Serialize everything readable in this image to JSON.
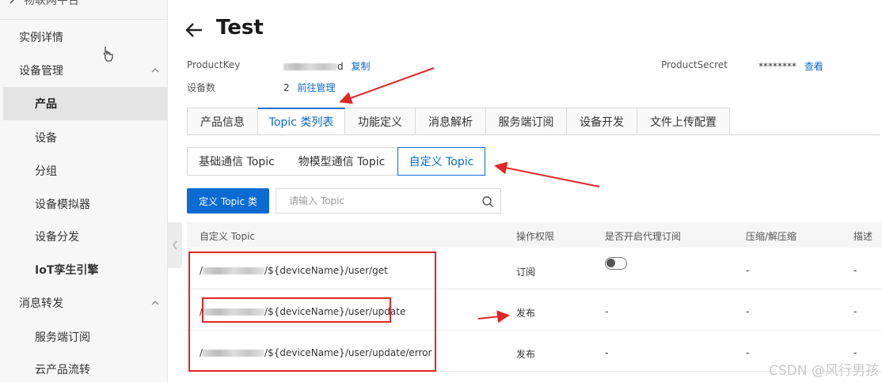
{
  "sidebar": {
    "top_partial": "物联网平台",
    "items": [
      {
        "label": "实例详情",
        "level": 1
      },
      {
        "label": "设备管理",
        "level": 1,
        "expandable": true
      },
      {
        "label": "产品",
        "level": 2,
        "active": true
      },
      {
        "label": "设备",
        "level": 2
      },
      {
        "label": "分组",
        "level": 2
      },
      {
        "label": "设备模拟器",
        "level": 2
      },
      {
        "label": "设备分发",
        "level": 2
      },
      {
        "label": "IoT孪生引擎",
        "level": 2
      },
      {
        "label": "消息转发",
        "level": 1,
        "expandable": true
      },
      {
        "label": "服务端订阅",
        "level": 2
      },
      {
        "label": "云产品流转",
        "level": 2
      }
    ]
  },
  "header": {
    "title": "Test",
    "product_key_label": "ProductKey",
    "product_key_tail": "d",
    "copy_link": "复制",
    "device_count_label": "设备数",
    "device_count": "2",
    "manage_link": "前往管理",
    "product_secret_label": "ProductSecret",
    "product_secret_value": "********",
    "view_link": "查看"
  },
  "tabs": [
    {
      "label": "产品信息"
    },
    {
      "label": "Topic 类列表",
      "active": true
    },
    {
      "label": "功能定义"
    },
    {
      "label": "消息解析"
    },
    {
      "label": "服务端订阅"
    },
    {
      "label": "设备开发"
    },
    {
      "label": "文件上传配置"
    }
  ],
  "subtabs": [
    {
      "label": "基础通信 Topic"
    },
    {
      "label": "物模型通信 Topic"
    },
    {
      "label": "自定义 Topic",
      "active": true
    }
  ],
  "toolbar": {
    "define_button": "定义 Topic 类",
    "search_placeholder": "请输入 Topic"
  },
  "table": {
    "headers": [
      "自定义 Topic",
      "操作权限",
      "是否开启代理订阅",
      "压缩/解压缩",
      "描述"
    ],
    "rows": [
      {
        "prefix": "/",
        "topic_suffix": "/${deviceName}/user/get",
        "permission": "订阅",
        "proxy": "toggle-off",
        "compress": "-",
        "desc": "-"
      },
      {
        "prefix": "/",
        "topic_suffix": "/${deviceName}/user/update",
        "permission": "发布",
        "proxy": "-",
        "compress": "-",
        "desc": "-"
      },
      {
        "prefix": "/",
        "topic_suffix": "/${deviceName}/user/update/error",
        "permission": "发布",
        "proxy": "-",
        "compress": "-",
        "desc": "-"
      }
    ]
  },
  "watermark": "CSDN @风行男孩",
  "colors": {
    "accent": "#0b6bd3",
    "annotation": "#e02727",
    "sidebar_bg": "#f7f7f7",
    "active_item_bg": "#e4e4e4"
  }
}
